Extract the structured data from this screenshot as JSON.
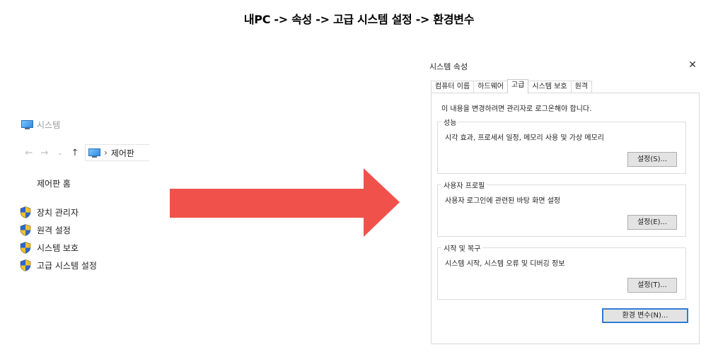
{
  "heading": "내PC -> 속성 -> 고급 시스템 설정 -> 환경변수",
  "explorer": {
    "window_title": "시스템",
    "nav": {
      "back_glyph": "←",
      "forward_glyph": "→",
      "recent_glyph": "⌄",
      "up_glyph": "↑"
    },
    "address": {
      "separator": "›",
      "path": "제어판"
    },
    "control_panel_home": "제어판 홈",
    "side_links": [
      {
        "label": "장치 관리자",
        "icon": "shield-icon"
      },
      {
        "label": "원격 설정",
        "icon": "shield-icon"
      },
      {
        "label": "시스템 보호",
        "icon": "shield-icon"
      },
      {
        "label": "고급 시스템 설정",
        "icon": "shield-icon"
      }
    ]
  },
  "arrow": {
    "color": "#f0524b"
  },
  "dialog": {
    "title": "시스템 속성",
    "close_glyph": "✕",
    "tabs": [
      "컴퓨터 이름",
      "하드웨어",
      "고급",
      "시스템 보호",
      "원격"
    ],
    "active_tab": "고급",
    "notice": "이 내용을 변경하려면 관리자로 로그온해야 합니다.",
    "groups": [
      {
        "title": "성능",
        "description": "시각 효과, 프로세서 일정, 메모리 사용 및 가상 메모리",
        "button": "설정(S)..."
      },
      {
        "title": "사용자 프로필",
        "description": "사용자 로그인에 관련된 바탕 화면 설정",
        "button": "설정(E)..."
      },
      {
        "title": "시작 및 복구",
        "description": "시스템 시작, 시스템 오류 및 디버깅 정보",
        "button": "설정(T)..."
      }
    ],
    "env_button": "환경 변수(N)...",
    "accent_color": "#2f7bd6"
  }
}
